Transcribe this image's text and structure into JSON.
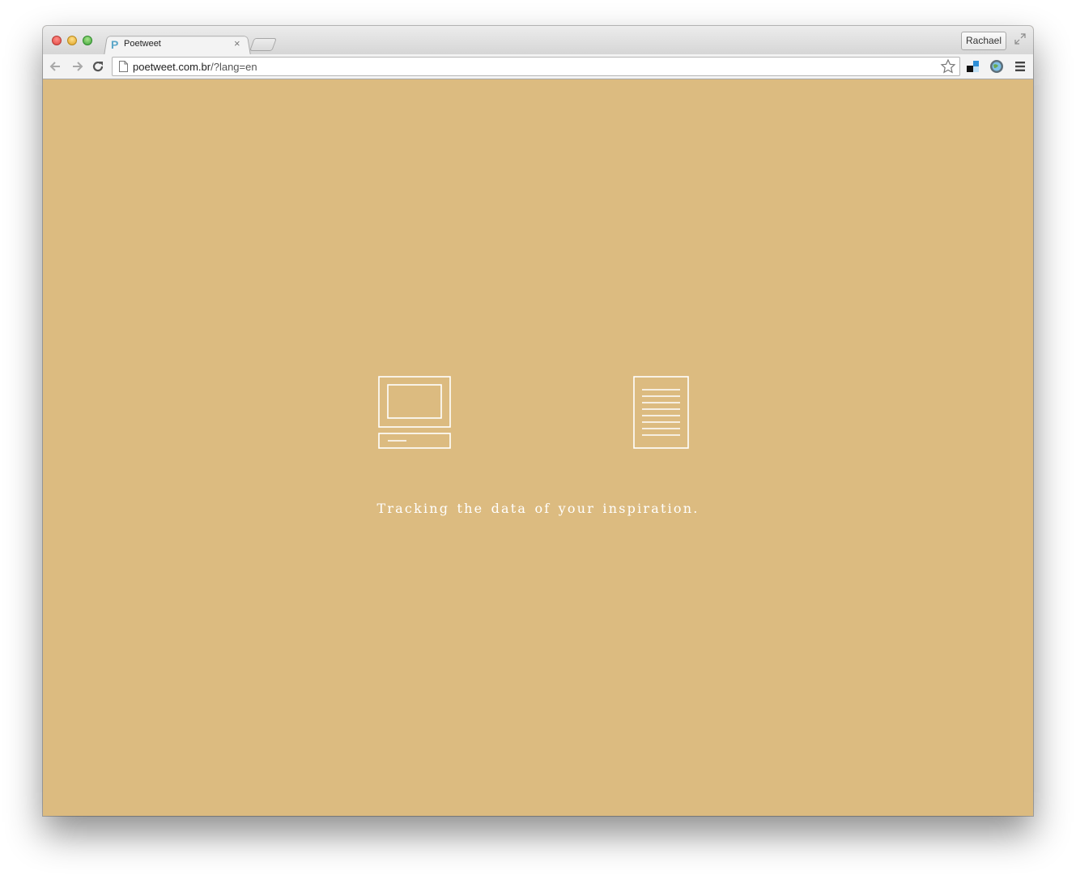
{
  "browser": {
    "tab": {
      "title": "Poetweet",
      "favicon_glyph": "P",
      "close_glyph": "×"
    },
    "profile_name": "Rachael",
    "address_bar": {
      "domain": "poetweet.com.br",
      "path": "/?lang=en"
    },
    "icons": [
      "back-icon",
      "forward-icon",
      "reload-icon",
      "page-icon",
      "star-icon",
      "extension-icon",
      "globe-extension-icon",
      "menu-icon",
      "fullscreen-icon"
    ]
  },
  "page": {
    "background_color": "#dcbb80",
    "foreground_color": "#ffffff",
    "illustrations": [
      "computer-icon",
      "document-icon"
    ],
    "tagline": "Tracking the data of your inspiration."
  }
}
